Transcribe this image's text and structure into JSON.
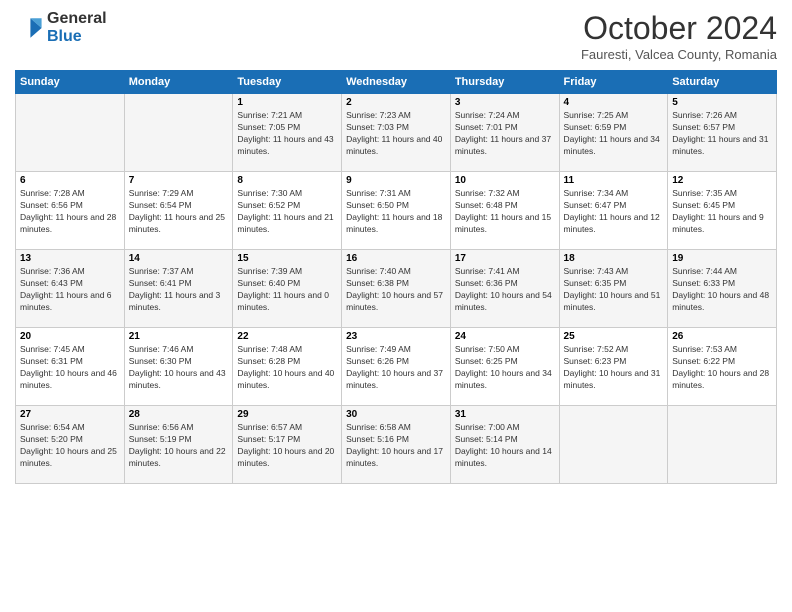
{
  "header": {
    "logo_line1": "General",
    "logo_line2": "Blue",
    "month": "October 2024",
    "location": "Fauresti, Valcea County, Romania"
  },
  "weekdays": [
    "Sunday",
    "Monday",
    "Tuesday",
    "Wednesday",
    "Thursday",
    "Friday",
    "Saturday"
  ],
  "weeks": [
    [
      {
        "day": "",
        "sunrise": "",
        "sunset": "",
        "daylight": ""
      },
      {
        "day": "",
        "sunrise": "",
        "sunset": "",
        "daylight": ""
      },
      {
        "day": "1",
        "sunrise": "Sunrise: 7:21 AM",
        "sunset": "Sunset: 7:05 PM",
        "daylight": "Daylight: 11 hours and 43 minutes."
      },
      {
        "day": "2",
        "sunrise": "Sunrise: 7:23 AM",
        "sunset": "Sunset: 7:03 PM",
        "daylight": "Daylight: 11 hours and 40 minutes."
      },
      {
        "day": "3",
        "sunrise": "Sunrise: 7:24 AM",
        "sunset": "Sunset: 7:01 PM",
        "daylight": "Daylight: 11 hours and 37 minutes."
      },
      {
        "day": "4",
        "sunrise": "Sunrise: 7:25 AM",
        "sunset": "Sunset: 6:59 PM",
        "daylight": "Daylight: 11 hours and 34 minutes."
      },
      {
        "day": "5",
        "sunrise": "Sunrise: 7:26 AM",
        "sunset": "Sunset: 6:57 PM",
        "daylight": "Daylight: 11 hours and 31 minutes."
      }
    ],
    [
      {
        "day": "6",
        "sunrise": "Sunrise: 7:28 AM",
        "sunset": "Sunset: 6:56 PM",
        "daylight": "Daylight: 11 hours and 28 minutes."
      },
      {
        "day": "7",
        "sunrise": "Sunrise: 7:29 AM",
        "sunset": "Sunset: 6:54 PM",
        "daylight": "Daylight: 11 hours and 25 minutes."
      },
      {
        "day": "8",
        "sunrise": "Sunrise: 7:30 AM",
        "sunset": "Sunset: 6:52 PM",
        "daylight": "Daylight: 11 hours and 21 minutes."
      },
      {
        "day": "9",
        "sunrise": "Sunrise: 7:31 AM",
        "sunset": "Sunset: 6:50 PM",
        "daylight": "Daylight: 11 hours and 18 minutes."
      },
      {
        "day": "10",
        "sunrise": "Sunrise: 7:32 AM",
        "sunset": "Sunset: 6:48 PM",
        "daylight": "Daylight: 11 hours and 15 minutes."
      },
      {
        "day": "11",
        "sunrise": "Sunrise: 7:34 AM",
        "sunset": "Sunset: 6:47 PM",
        "daylight": "Daylight: 11 hours and 12 minutes."
      },
      {
        "day": "12",
        "sunrise": "Sunrise: 7:35 AM",
        "sunset": "Sunset: 6:45 PM",
        "daylight": "Daylight: 11 hours and 9 minutes."
      }
    ],
    [
      {
        "day": "13",
        "sunrise": "Sunrise: 7:36 AM",
        "sunset": "Sunset: 6:43 PM",
        "daylight": "Daylight: 11 hours and 6 minutes."
      },
      {
        "day": "14",
        "sunrise": "Sunrise: 7:37 AM",
        "sunset": "Sunset: 6:41 PM",
        "daylight": "Daylight: 11 hours and 3 minutes."
      },
      {
        "day": "15",
        "sunrise": "Sunrise: 7:39 AM",
        "sunset": "Sunset: 6:40 PM",
        "daylight": "Daylight: 11 hours and 0 minutes."
      },
      {
        "day": "16",
        "sunrise": "Sunrise: 7:40 AM",
        "sunset": "Sunset: 6:38 PM",
        "daylight": "Daylight: 10 hours and 57 minutes."
      },
      {
        "day": "17",
        "sunrise": "Sunrise: 7:41 AM",
        "sunset": "Sunset: 6:36 PM",
        "daylight": "Daylight: 10 hours and 54 minutes."
      },
      {
        "day": "18",
        "sunrise": "Sunrise: 7:43 AM",
        "sunset": "Sunset: 6:35 PM",
        "daylight": "Daylight: 10 hours and 51 minutes."
      },
      {
        "day": "19",
        "sunrise": "Sunrise: 7:44 AM",
        "sunset": "Sunset: 6:33 PM",
        "daylight": "Daylight: 10 hours and 48 minutes."
      }
    ],
    [
      {
        "day": "20",
        "sunrise": "Sunrise: 7:45 AM",
        "sunset": "Sunset: 6:31 PM",
        "daylight": "Daylight: 10 hours and 46 minutes."
      },
      {
        "day": "21",
        "sunrise": "Sunrise: 7:46 AM",
        "sunset": "Sunset: 6:30 PM",
        "daylight": "Daylight: 10 hours and 43 minutes."
      },
      {
        "day": "22",
        "sunrise": "Sunrise: 7:48 AM",
        "sunset": "Sunset: 6:28 PM",
        "daylight": "Daylight: 10 hours and 40 minutes."
      },
      {
        "day": "23",
        "sunrise": "Sunrise: 7:49 AM",
        "sunset": "Sunset: 6:26 PM",
        "daylight": "Daylight: 10 hours and 37 minutes."
      },
      {
        "day": "24",
        "sunrise": "Sunrise: 7:50 AM",
        "sunset": "Sunset: 6:25 PM",
        "daylight": "Daylight: 10 hours and 34 minutes."
      },
      {
        "day": "25",
        "sunrise": "Sunrise: 7:52 AM",
        "sunset": "Sunset: 6:23 PM",
        "daylight": "Daylight: 10 hours and 31 minutes."
      },
      {
        "day": "26",
        "sunrise": "Sunrise: 7:53 AM",
        "sunset": "Sunset: 6:22 PM",
        "daylight": "Daylight: 10 hours and 28 minutes."
      }
    ],
    [
      {
        "day": "27",
        "sunrise": "Sunrise: 6:54 AM",
        "sunset": "Sunset: 5:20 PM",
        "daylight": "Daylight: 10 hours and 25 minutes."
      },
      {
        "day": "28",
        "sunrise": "Sunrise: 6:56 AM",
        "sunset": "Sunset: 5:19 PM",
        "daylight": "Daylight: 10 hours and 22 minutes."
      },
      {
        "day": "29",
        "sunrise": "Sunrise: 6:57 AM",
        "sunset": "Sunset: 5:17 PM",
        "daylight": "Daylight: 10 hours and 20 minutes."
      },
      {
        "day": "30",
        "sunrise": "Sunrise: 6:58 AM",
        "sunset": "Sunset: 5:16 PM",
        "daylight": "Daylight: 10 hours and 17 minutes."
      },
      {
        "day": "31",
        "sunrise": "Sunrise: 7:00 AM",
        "sunset": "Sunset: 5:14 PM",
        "daylight": "Daylight: 10 hours and 14 minutes."
      },
      {
        "day": "",
        "sunrise": "",
        "sunset": "",
        "daylight": ""
      },
      {
        "day": "",
        "sunrise": "",
        "sunset": "",
        "daylight": ""
      }
    ]
  ]
}
